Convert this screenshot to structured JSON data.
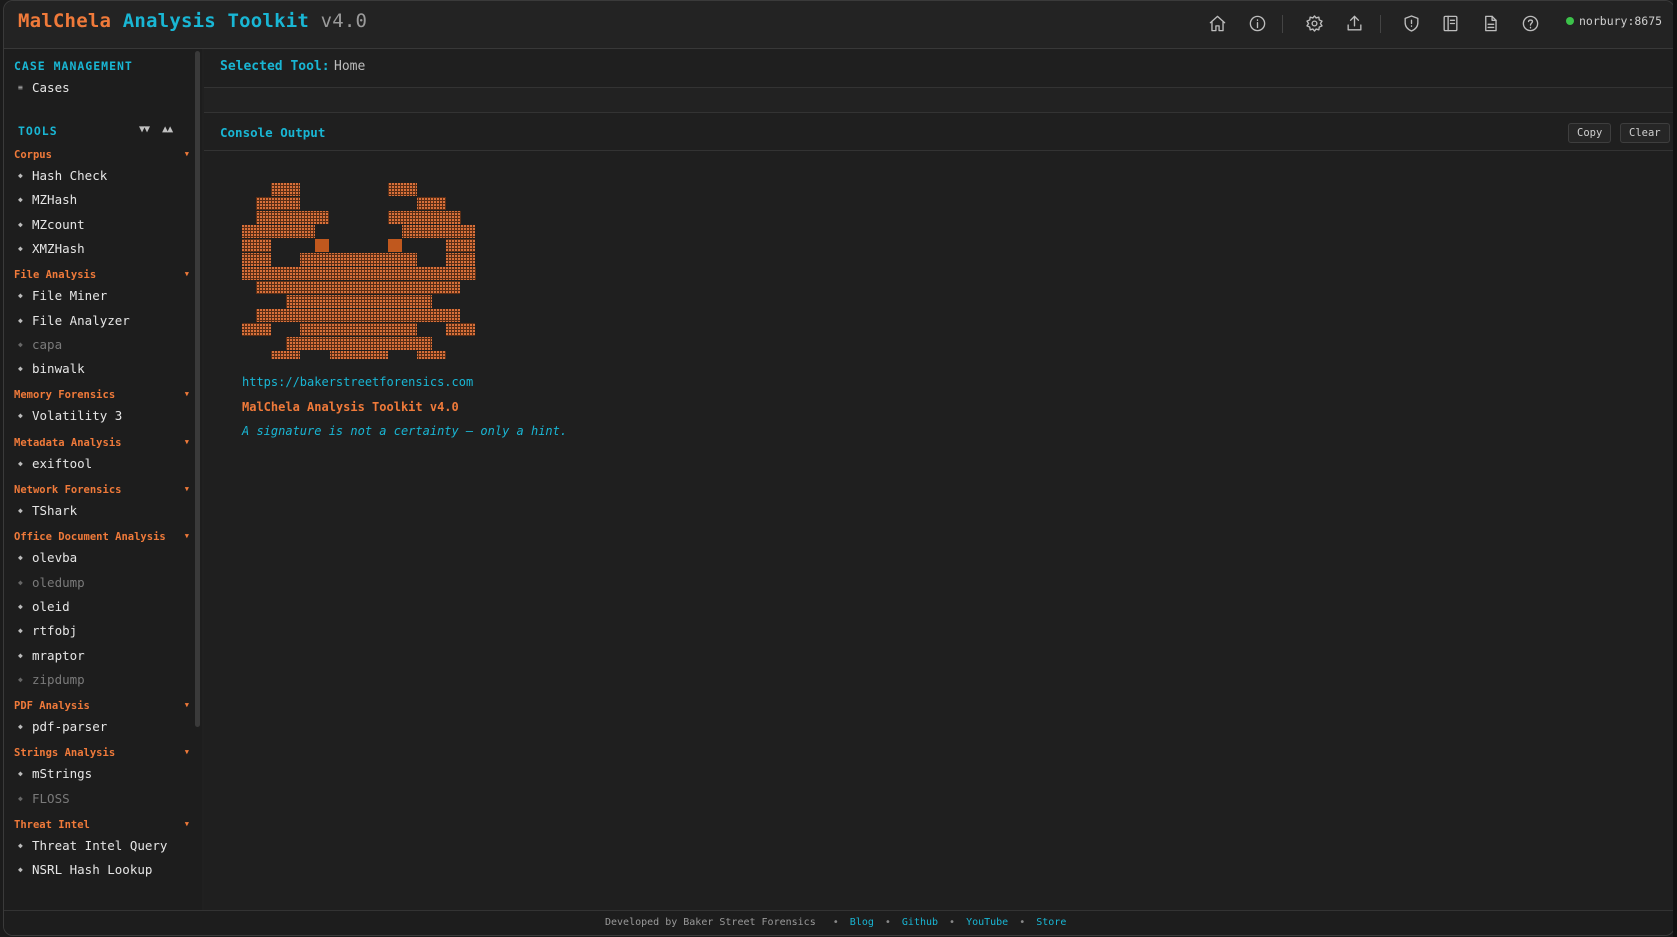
{
  "app": {
    "title_part1": "MalChela",
    "title_part2": "Analysis Toolkit",
    "version": "v4.0",
    "status": "norbury:8675"
  },
  "header_icons": [
    "home-icon",
    "info-icon",
    "settings-icon",
    "upload-icon",
    "shield-icon",
    "notebook-icon",
    "document-icon",
    "help-icon"
  ],
  "sidebar": {
    "case_title": "CASE MANAGEMENT",
    "cases_label": "Cases",
    "tools_title": "TOOLS",
    "collapse_all": "▼▼",
    "expand_all": "▲▲",
    "categories": [
      {
        "name": "Corpus",
        "items": [
          {
            "label": "Hash Check",
            "enabled": true
          },
          {
            "label": "MZHash",
            "enabled": true
          },
          {
            "label": "MZcount",
            "enabled": true
          },
          {
            "label": "XMZHash",
            "enabled": true
          }
        ]
      },
      {
        "name": "File Analysis",
        "items": [
          {
            "label": "File Miner",
            "enabled": true
          },
          {
            "label": "File Analyzer",
            "enabled": true
          },
          {
            "label": "capa",
            "enabled": false
          },
          {
            "label": "binwalk",
            "enabled": true
          }
        ]
      },
      {
        "name": "Memory Forensics",
        "items": [
          {
            "label": "Volatility 3",
            "enabled": true
          }
        ]
      },
      {
        "name": "Metadata Analysis",
        "items": [
          {
            "label": "exiftool",
            "enabled": true
          }
        ]
      },
      {
        "name": "Network Forensics",
        "items": [
          {
            "label": "TShark",
            "enabled": true
          }
        ]
      },
      {
        "name": "Office Document Analysis",
        "items": [
          {
            "label": "olevba",
            "enabled": true
          },
          {
            "label": "oledump",
            "enabled": false
          },
          {
            "label": "oleid",
            "enabled": true
          },
          {
            "label": "rtfobj",
            "enabled": true
          },
          {
            "label": "mraptor",
            "enabled": true
          },
          {
            "label": "zipdump",
            "enabled": false
          }
        ]
      },
      {
        "name": "PDF Analysis",
        "items": [
          {
            "label": "pdf-parser",
            "enabled": true
          }
        ]
      },
      {
        "name": "Strings Analysis",
        "items": [
          {
            "label": "mStrings",
            "enabled": true
          },
          {
            "label": "FLOSS",
            "enabled": false
          }
        ]
      },
      {
        "name": "Threat Intel",
        "items": [
          {
            "label": "Threat Intel Query",
            "enabled": true
          },
          {
            "label": "NSRL Hash Lookup",
            "enabled": true
          }
        ]
      }
    ]
  },
  "main": {
    "selected_tool_label": "Selected Tool:",
    "selected_tool_value": "Home",
    "console_title": "Console Output",
    "copy_label": "Copy",
    "clear_label": "Clear",
    "console": {
      "url": "https://bakerstreetforensics.com",
      "version_line": "MalChela Analysis Toolkit v4.0",
      "tagline": "A signature is not a certainty — only a hint."
    }
  },
  "footer": {
    "developed_by": "Developed by Baker Street Forensics",
    "links": [
      "Blog",
      "Github",
      "YouTube",
      "Store"
    ]
  },
  "colors": {
    "accent_orange": "#f07a3a",
    "accent_cyan": "#19b6d4",
    "status_green": "#3cc24a"
  }
}
